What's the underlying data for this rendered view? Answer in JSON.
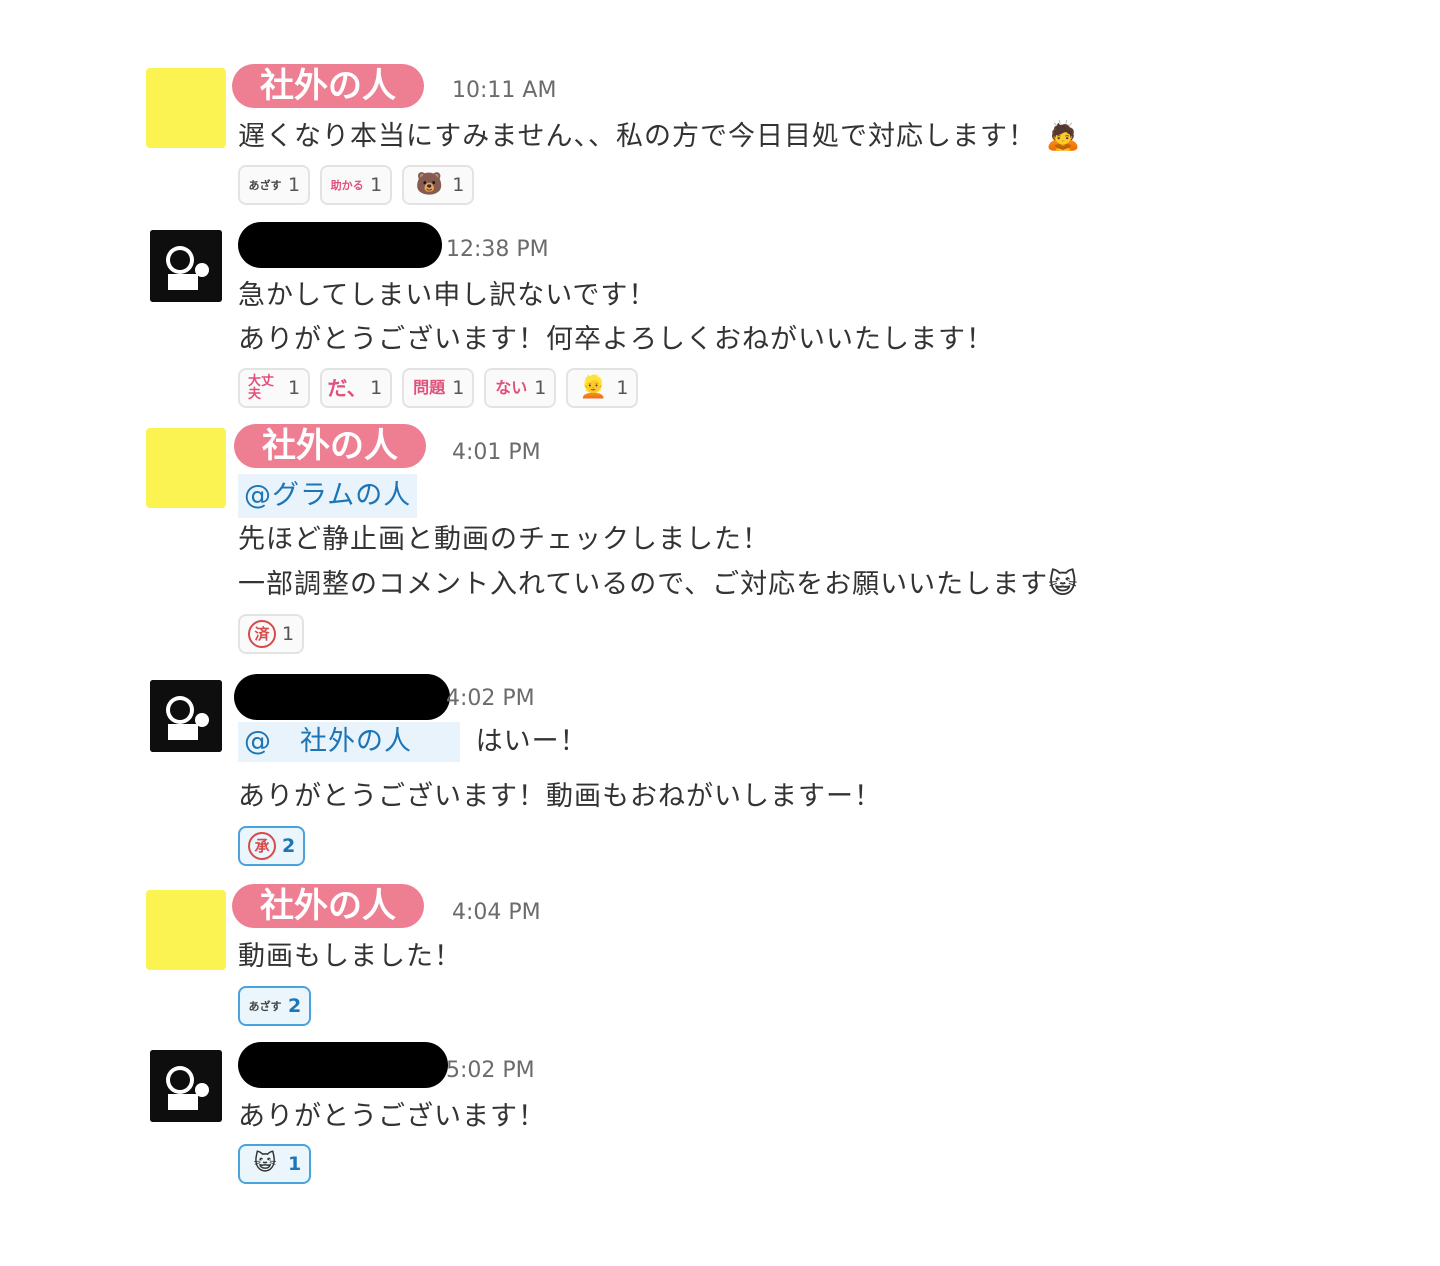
{
  "messages": [
    {
      "sender": "社外の人",
      "time": "10:11 AM",
      "lines": [
        "遅くなり本当にすみません、、私の方で今日目処で対応します！"
      ],
      "trailing_emoji": "bowing-person",
      "reactions": [
        {
          "emoji": "あざす",
          "count": "1"
        },
        {
          "emoji": "助かる",
          "count": "1"
        },
        {
          "emoji": "bear-face",
          "count": "1"
        }
      ]
    },
    {
      "sender_redacted": true,
      "time": "12:38 PM",
      "lines": [
        "急かしてしまい申し訳ないです！",
        "ありがとうございます！何卒よろしくおねがいいたします！"
      ],
      "reactions": [
        {
          "emoji": "大丈夫",
          "count": "1"
        },
        {
          "emoji": "だ、",
          "count": "1"
        },
        {
          "emoji": "問題",
          "count": "1"
        },
        {
          "emoji": "ない",
          "count": "1"
        },
        {
          "emoji": "person-face",
          "count": "1"
        }
      ]
    },
    {
      "sender": "社外の人",
      "time": "4:01 PM",
      "mention": "@グラムの人",
      "lines": [
        "先ほど静止画と動画のチェックしました！",
        "一部調整のコメント入れているので、ご対応をお願いいたします"
      ],
      "trailing_emoji": "cat-face",
      "reactions": [
        {
          "emoji": "済",
          "count": "1"
        }
      ]
    },
    {
      "sender_redacted": true,
      "time": "4:02 PM",
      "mention": "@　社外の人",
      "mention_suffix": "はいー！",
      "lines": [
        "ありがとうございます！動画もおねがいしますー！"
      ],
      "reactions": [
        {
          "emoji": "承",
          "count": "2",
          "mine": true
        }
      ]
    },
    {
      "sender": "社外の人",
      "time": "4:04 PM",
      "lines": [
        "動画もしました！"
      ],
      "reactions": [
        {
          "emoji": "あざす",
          "count": "2",
          "mine": true
        }
      ]
    },
    {
      "sender_redacted": true,
      "time": "5:02 PM",
      "lines": [
        "ありがとうございます！"
      ],
      "reactions": [
        {
          "emoji": "cat-face",
          "count": "1",
          "mine": true
        }
      ]
    }
  ]
}
